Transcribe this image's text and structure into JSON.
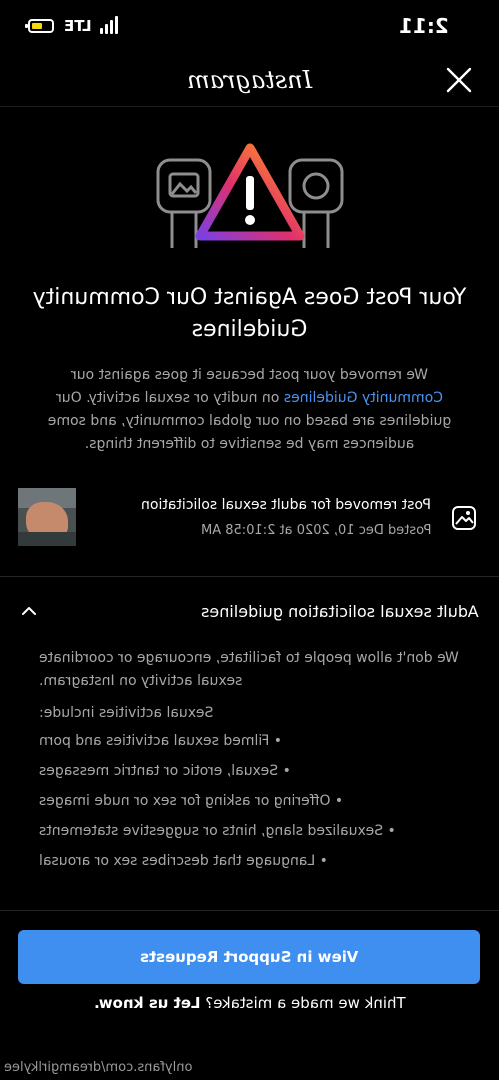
{
  "status_bar": {
    "network": "LTE",
    "time": "2:11"
  },
  "header": {
    "logo_text": "Instagram"
  },
  "notice": {
    "title": "Your Post Goes Against Our Community Guidelines",
    "body_part1": "We removed your post because it goes against our",
    "body_link": "Community Guidelines",
    "body_part2": "on nudity or sexual activity. Our guidelines are based on our global community, and some audiences may be sensitive to different things."
  },
  "post": {
    "title": "Post removed for adult sexual solicitation",
    "date": "Posted Dec 10, 2020 at 2:10:58 AM"
  },
  "guidelines": {
    "title": "Adult sexual solicitation guidelines",
    "intro": "We don't allow people to facilitate, encourage or coordinate sexual activity on Instagram.",
    "list_heading": "Sexual activities include:",
    "items": [
      "Filmed sexual activities and porn",
      "Sexual, erotic or tantric messages",
      "Offering or asking for sex or nude images",
      "Sexualized slang, hints or suggestive statements",
      "Language that describes sex or arousal"
    ]
  },
  "actions": {
    "support_button": "View in Support Requests",
    "mistake_text": "Think we made a mistake?",
    "mistake_link": "Let us know."
  },
  "watermark": "onlyfans.com/dreamgirlkylee",
  "colors": {
    "link": "#4a95f2",
    "button": "#3e8ff0",
    "battery": "#f5d90a"
  }
}
